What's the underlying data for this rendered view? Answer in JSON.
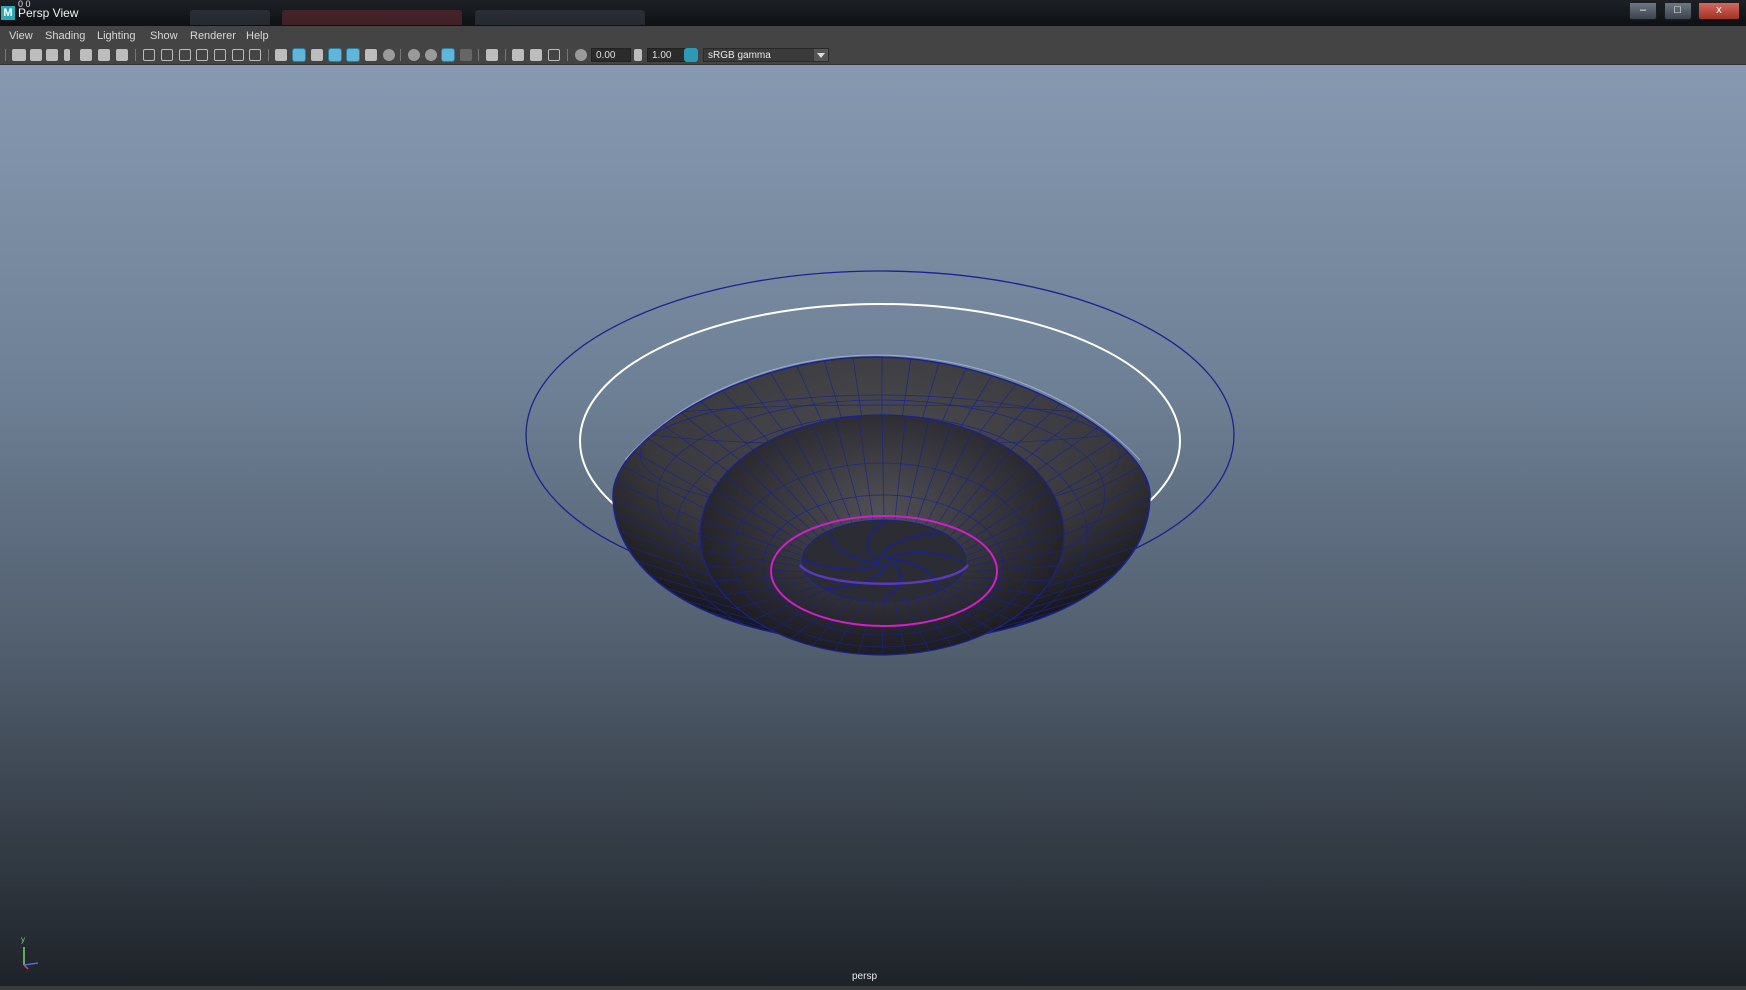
{
  "window": {
    "title": "Persp View",
    "app_icon": "M",
    "tick_marks": "0                    0",
    "controls": {
      "minimize": "–",
      "maximize": "□",
      "close": "x"
    }
  },
  "menu": [
    "View",
    "Shading",
    "Lighting",
    "Show",
    "Renderer",
    "Help"
  ],
  "toolbar": {
    "exposure_value": "0.00",
    "gamma_value": "1.00",
    "color_space": "sRGB gamma"
  },
  "viewport": {
    "camera_label": "persp",
    "axis_y": "y",
    "colors": {
      "wire": "#1a2290",
      "outer_ring": "#ffffff",
      "inner_ring": "#d020c8",
      "bg_top": "#8699b0",
      "bg_bottom": "#1d2227"
    }
  }
}
